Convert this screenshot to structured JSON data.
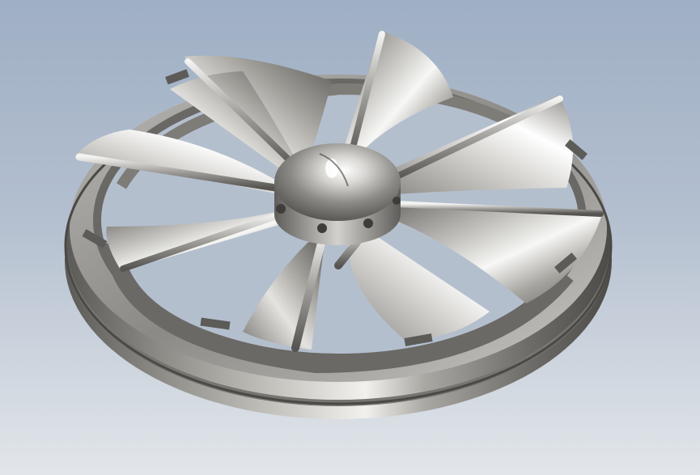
{
  "scene": {
    "subject": "impeller-model",
    "blade_count": 9,
    "background": {
      "top": "#9fafc4",
      "bottom": "#e2e6ea"
    },
    "material_colors": {
      "metal_dark": "#4f4e4c",
      "metal_mid": "#8f8d89",
      "metal_light": "#d9d8d4",
      "highlight": "#ffffff"
    }
  }
}
